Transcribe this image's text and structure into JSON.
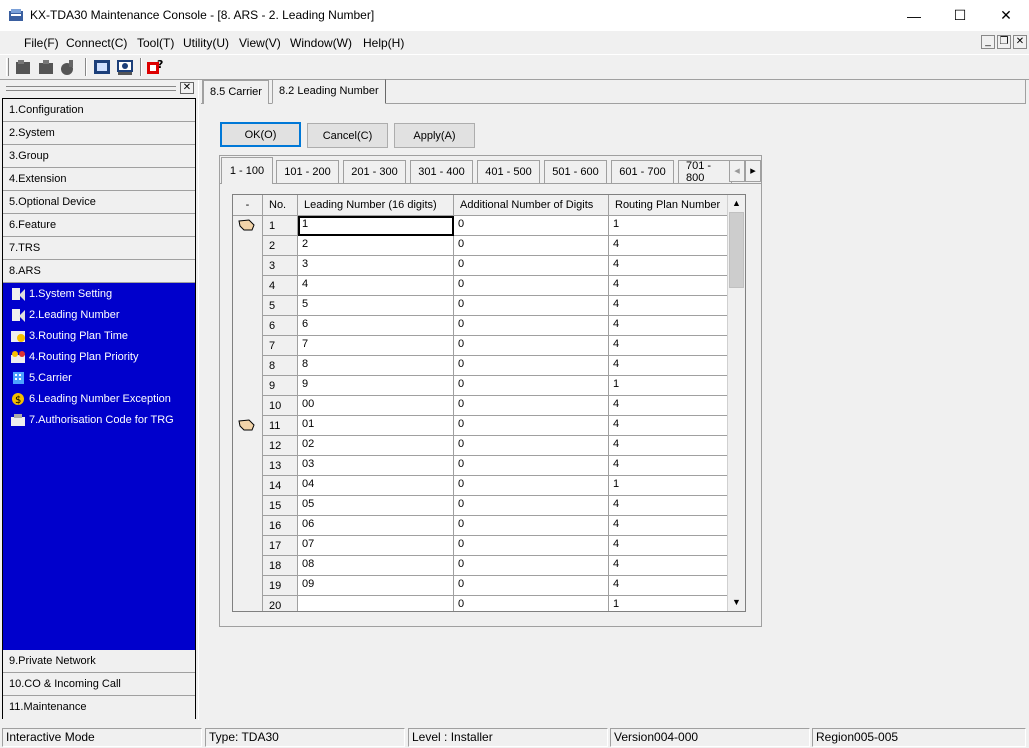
{
  "window": {
    "title": "KX-TDA30 Maintenance Console - [8. ARS - 2. Leading Number]",
    "controls": {
      "minimize": "—",
      "maximize": "☐",
      "close": "✕"
    }
  },
  "menu": [
    "File(F)",
    "Connect(C)",
    "Tool(T)",
    "Utility(U)",
    "View(V)",
    "Window(W)",
    "Help(H)"
  ],
  "mdi_controls": {
    "minimize": "_",
    "restore": "❐",
    "close": "✕"
  },
  "toolbar_icons": [
    "disconnect-icon",
    "connect-icon",
    "tool-icon",
    "program-icon",
    "maintenance-icon",
    "help-icon"
  ],
  "left_panel": {
    "close": "✕",
    "sections_top": [
      "1.Configuration",
      "2.System",
      "3.Group",
      "4.Extension",
      "5.Optional Device",
      "6.Feature",
      "7.TRS",
      "8.ARS"
    ],
    "ars_items": [
      "1.System Setting",
      "2.Leading Number",
      "3.Routing Plan Time",
      "4.Routing Plan Priority",
      "5.Carrier",
      "6.Leading Number Exception",
      "7.Authorisation Code for TRG"
    ],
    "sections_bottom": [
      "9.Private Network",
      "10.CO & Incoming Call",
      "11.Maintenance"
    ]
  },
  "doc_tabs": [
    "8.5 Carrier",
    "8.2 Leading Number"
  ],
  "buttons": {
    "ok": "OK(O)",
    "cancel": "Cancel(C)",
    "apply": "Apply(A)"
  },
  "range_tabs": [
    "1 - 100",
    "101 - 200",
    "201 - 300",
    "301 - 400",
    "401 - 500",
    "501 - 600",
    "601 - 700",
    "701 - 800"
  ],
  "range_scroll": {
    "left": "◂",
    "right": "▸"
  },
  "grid": {
    "headers": {
      "sel": "-",
      "no": "No.",
      "lead": "Leading Number (16 digits)",
      "add": "Additional Number of Digits",
      "route": "Routing Plan Number"
    },
    "rows": [
      {
        "no": "1",
        "lead": "1",
        "add": "0",
        "route": "1"
      },
      {
        "no": "2",
        "lead": "2",
        "add": "0",
        "route": "4"
      },
      {
        "no": "3",
        "lead": "3",
        "add": "0",
        "route": "4"
      },
      {
        "no": "4",
        "lead": "4",
        "add": "0",
        "route": "4"
      },
      {
        "no": "5",
        "lead": "5",
        "add": "0",
        "route": "4"
      },
      {
        "no": "6",
        "lead": "6",
        "add": "0",
        "route": "4"
      },
      {
        "no": "7",
        "lead": "7",
        "add": "0",
        "route": "4"
      },
      {
        "no": "8",
        "lead": "8",
        "add": "0",
        "route": "4"
      },
      {
        "no": "9",
        "lead": "9",
        "add": "0",
        "route": "1"
      },
      {
        "no": "10",
        "lead": "00",
        "add": "0",
        "route": "4"
      },
      {
        "no": "11",
        "lead": "01",
        "add": "0",
        "route": "4"
      },
      {
        "no": "12",
        "lead": "02",
        "add": "0",
        "route": "4"
      },
      {
        "no": "13",
        "lead": "03",
        "add": "0",
        "route": "4"
      },
      {
        "no": "14",
        "lead": "04",
        "add": "0",
        "route": "1"
      },
      {
        "no": "15",
        "lead": "05",
        "add": "0",
        "route": "4"
      },
      {
        "no": "16",
        "lead": "06",
        "add": "0",
        "route": "4"
      },
      {
        "no": "17",
        "lead": "07",
        "add": "0",
        "route": "4"
      },
      {
        "no": "18",
        "lead": "08",
        "add": "0",
        "route": "4"
      },
      {
        "no": "19",
        "lead": "09",
        "add": "0",
        "route": "4"
      },
      {
        "no": "20",
        "lead": "",
        "add": "0",
        "route": "1"
      }
    ],
    "scroll": {
      "up": "▲",
      "down": "▼"
    }
  },
  "status": [
    "Interactive Mode",
    "Type: TDA30",
    "Level : Installer",
    "Version004-000",
    "Region005-005"
  ]
}
